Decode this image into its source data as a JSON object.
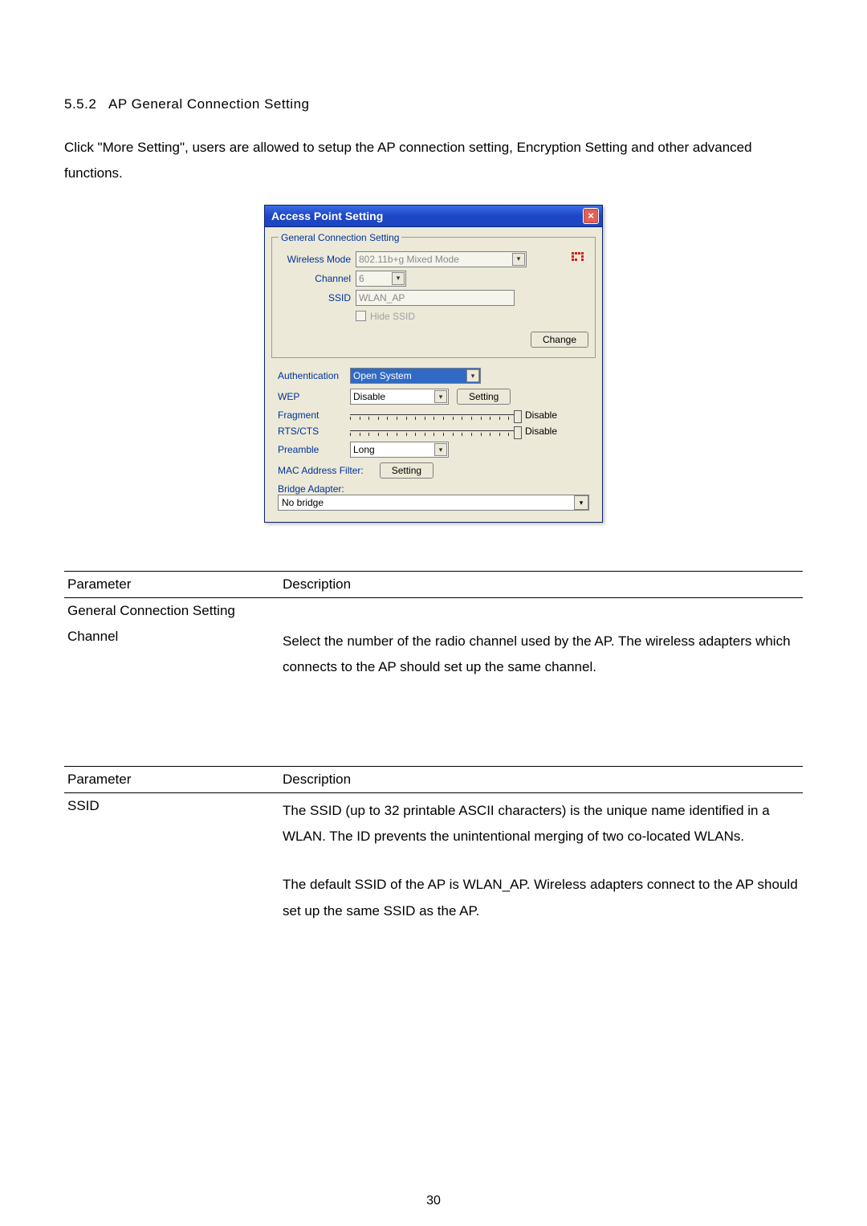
{
  "section": {
    "number": "5.5.2",
    "title": "AP General Connection Setting"
  },
  "intro": "Click \"More Setting\", users are allowed to setup the AP connection setting, Encryption Setting and other advanced functions.",
  "dialog": {
    "title": "Access Point Setting",
    "group_legend": "General Connection Setting",
    "wireless_mode_label": "Wireless Mode",
    "wireless_mode_value": "802.11b+g Mixed Mode",
    "channel_label": "Channel",
    "channel_value": "6",
    "ssid_label": "SSID",
    "ssid_value": "WLAN_AP",
    "hide_ssid_label": "Hide SSID",
    "change_btn": "Change",
    "auth_label": "Authentication",
    "auth_value": "Open System",
    "wep_label": "WEP",
    "wep_value": "Disable",
    "setting_btn": "Setting",
    "fragment_label": "Fragment",
    "fragment_status": "Disable",
    "rtscts_label": "RTS/CTS",
    "rtscts_status": "Disable",
    "preamble_label": "Preamble",
    "preamble_value": "Long",
    "mac_filter_label": "MAC Address Filter:",
    "bridge_label": "Bridge Adapter:",
    "bridge_value": "No bridge"
  },
  "table1": {
    "head_parameter": "Parameter",
    "head_description": "Description",
    "rows": [
      {
        "param": "General Connection Setting",
        "desc": ""
      },
      {
        "param": "Channel",
        "desc": "Select the number of the radio channel used by the AP. The wireless adapters which connects to the AP should set up the same channel."
      }
    ]
  },
  "table2": {
    "head_parameter": "Parameter",
    "head_description": "Description",
    "rows": [
      {
        "param": "SSID",
        "desc1": "The SSID (up to 32 printable ASCII characters) is the unique name identified in a WLAN. The ID prevents the unintentional merging of two co-located WLANs.",
        "desc2": "The default SSID of the AP is WLAN_AP. Wireless adapters connect to the AP should set up the same SSID as the AP."
      }
    ]
  },
  "page_number": "30"
}
